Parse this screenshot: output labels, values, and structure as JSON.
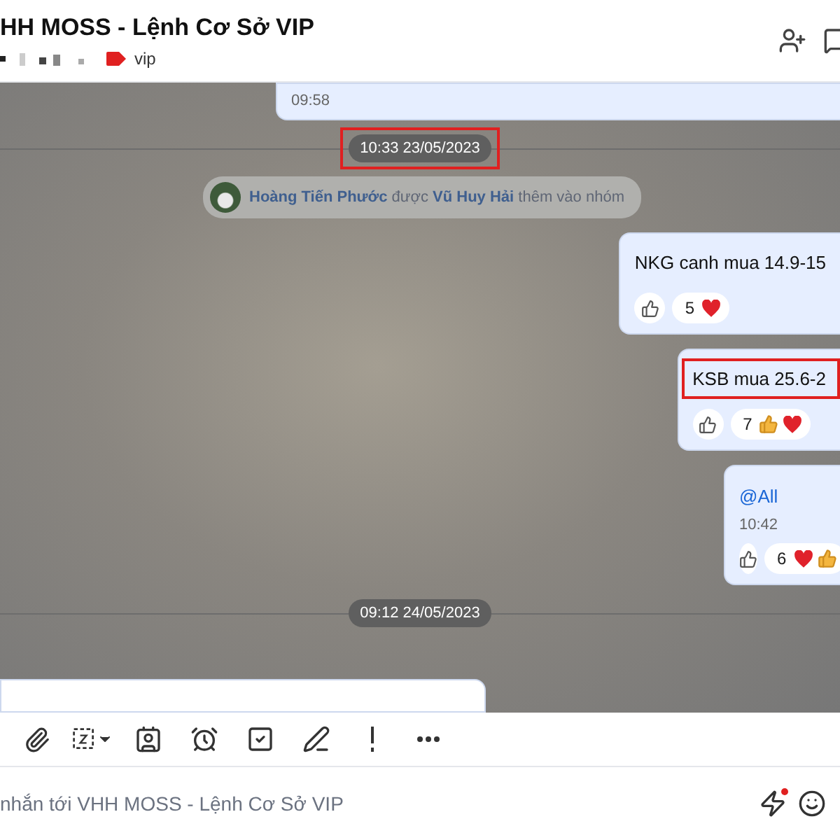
{
  "header": {
    "title": "HH MOSS - Lệnh Cơ Sở VIP",
    "tag": "vip"
  },
  "messages": [
    {
      "kind": "outgoing_top",
      "time": "09:58"
    },
    {
      "kind": "timestamp",
      "text": "10:33 23/05/2023",
      "highlighted": true
    },
    {
      "kind": "system",
      "text": "**Hoàng Tiến Phước** được **Vũ Huy Hải** thêm vào nhóm"
    },
    {
      "kind": "outgoing",
      "text": "NKG canh mua 14.9-15",
      "reactions": {
        "count": "5",
        "emojis": [
          {
            "kind": "heart"
          }
        ]
      },
      "highlighted": false
    },
    {
      "kind": "outgoing",
      "text": "KSB mua 25.6-2",
      "reactions": {
        "count": "7",
        "emojis": [
          {
            "kind": "thumb"
          },
          {
            "kind": "heart"
          }
        ]
      },
      "highlighted": true
    },
    {
      "kind": "outgoing",
      "mention": "@All",
      "time": "10:42",
      "reactions": {
        "count": "6",
        "emojis": [
          {
            "kind": "heart"
          },
          {
            "kind": "thumb"
          }
        ]
      }
    },
    {
      "kind": "timestamp",
      "text": "09:12 24/05/2023",
      "highlighted": false
    },
    {
      "kind": "incoming_cut"
    }
  ],
  "toolbar": [
    {
      "kind": "attach"
    },
    {
      "kind": "screenshot"
    },
    {
      "kind": "card"
    },
    {
      "kind": "reminder"
    },
    {
      "kind": "task"
    },
    {
      "kind": "format"
    },
    {
      "kind": "important"
    },
    {
      "kind": "more"
    }
  ],
  "composer": {
    "placeholder": "nhắn tới VHH MOSS - Lệnh Cơ Sở VIP",
    "quick_reply_badge": true
  }
}
